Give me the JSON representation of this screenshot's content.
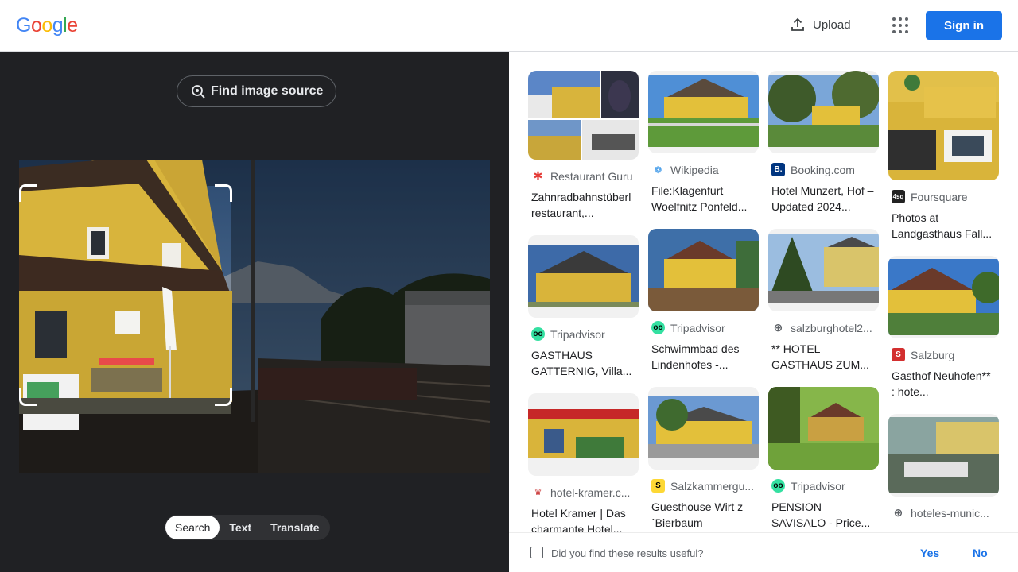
{
  "header": {
    "logo_letters": [
      "G",
      "o",
      "o",
      "g",
      "l",
      "e"
    ],
    "logo_colors": [
      "#4285f4",
      "#ea4335",
      "#fbbc05",
      "#4285f4",
      "#34a853",
      "#ea4335"
    ],
    "upload_label": "Upload",
    "signin_label": "Sign in"
  },
  "left": {
    "find_source_label": "Find image source",
    "modes": [
      {
        "label": "Search",
        "active": true
      },
      {
        "label": "Text",
        "active": false
      },
      {
        "label": "Translate",
        "active": false
      }
    ]
  },
  "results": [
    {
      "source": "Restaurant Guru",
      "favicon": "star-icon",
      "fav_color": "#e53935",
      "title": "Zahnradbahnstüberl restaurant,..."
    },
    {
      "source": "Tripadvisor",
      "favicon": "owl-icon",
      "fav_color": "#34e0a1",
      "title": "GASTHAUS GATTERNIG, Villa..."
    },
    {
      "source": "hotel-kramer.c...",
      "favicon": "crown-icon",
      "fav_color": "#c62828",
      "title": "Hotel Kramer | Das charmante Hotel..."
    },
    {
      "source": "Wikipedia",
      "favicon": "wiki-icon",
      "fav_color": "#1e88e5",
      "title": "File:Klagenfurt Woelfnitz Ponfeld..."
    },
    {
      "source": "Tripadvisor",
      "favicon": "owl-icon",
      "fav_color": "#34e0a1",
      "title": "Schwimmbad des Lindenhofes -..."
    },
    {
      "source": "Salzkammergu...",
      "favicon": "s-icon",
      "fav_color": "#fdd835",
      "title": "Guesthouse Wirt z ´Bierbaum"
    },
    {
      "source": "Booking.com",
      "favicon": "b-icon",
      "fav_color": "#003580",
      "title": "Hotel Munzert, Hof – Updated 2024..."
    },
    {
      "source": "salzburghotel2...",
      "favicon": "globe-icon",
      "fav_color": "#5f6368",
      "title": "** HOTEL GASTHAUS ZUM..."
    },
    {
      "source": "Tripadvisor",
      "favicon": "owl-icon",
      "fav_color": "#34e0a1",
      "title": "PENSION SAVISALO - Price..."
    },
    {
      "source": "Foursquare",
      "favicon": "foursquare-icon",
      "fav_color": "#222",
      "title": "Photos at Landgasthaus Fall..."
    },
    {
      "source": "Salzburg",
      "favicon": "s-red-icon",
      "fav_color": "#d32f2f",
      "title": "Gasthof Neuhofen** : hote..."
    },
    {
      "source": "hoteles-munic...",
      "favicon": "globe-icon",
      "fav_color": "#5f6368",
      "title": ""
    }
  ],
  "feedback": {
    "question": "Did you find these results useful?",
    "yes": "Yes",
    "no": "No"
  }
}
